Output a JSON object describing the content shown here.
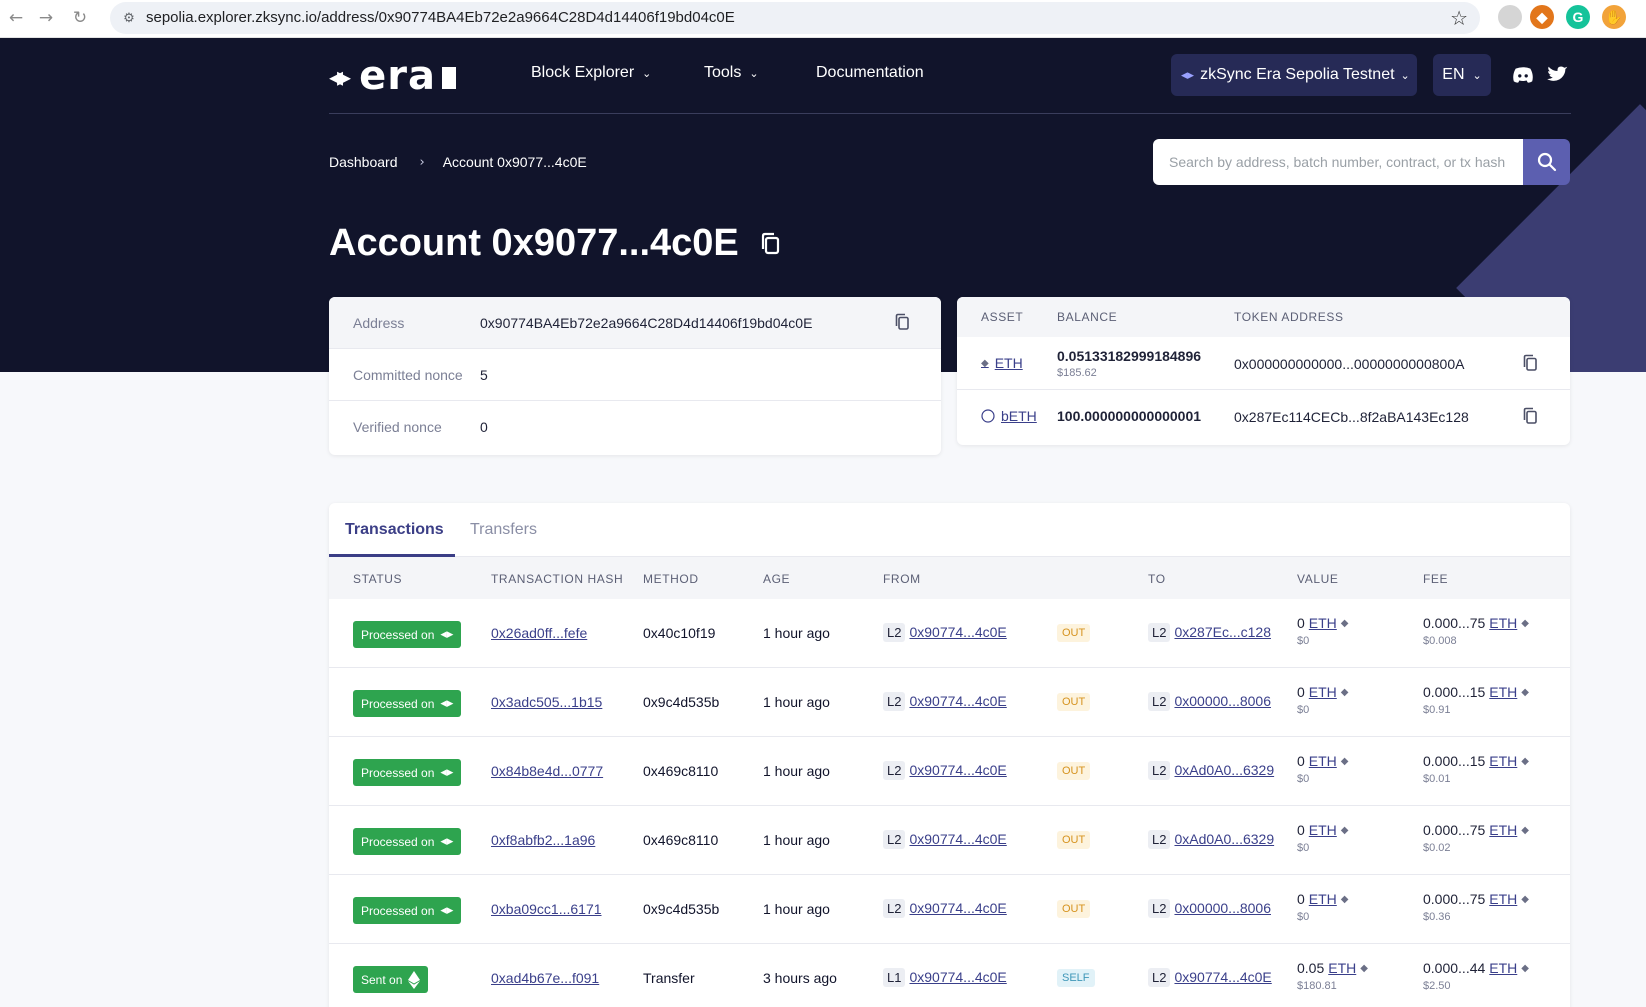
{
  "browser": {
    "url": "sepolia.explorer.zksync.io/address/0x90774BA4Eb72e2a9664C28D4d14406f19bd04c0E"
  },
  "header": {
    "logo": "era",
    "menu": [
      {
        "label": "Block Explorer"
      },
      {
        "label": "Tools"
      },
      {
        "label": "Documentation"
      }
    ],
    "network": "zkSync Era Sepolia Testnet",
    "language": "EN"
  },
  "breadcrumb": {
    "home": "Dashboard",
    "current": "Account 0x9077...4c0E"
  },
  "search": {
    "placeholder": "Search by address, batch number, contract, or tx hash"
  },
  "page": {
    "title": "Account 0x9077...4c0E"
  },
  "account_info": {
    "address_label": "Address",
    "address_value": "0x90774BA4Eb72e2a9664C28D4d14406f19bd04c0E",
    "committed_label": "Committed nonce",
    "committed_value": "5",
    "verified_label": "Verified nonce",
    "verified_value": "0"
  },
  "assets": {
    "headers": {
      "asset": "ASSET",
      "balance": "BALANCE",
      "token_address": "TOKEN ADDRESS"
    },
    "rows": [
      {
        "name": "ETH",
        "balance": "0.05133182999184896",
        "usd": "$185.62",
        "address": "0x000000000000...0000000000800A"
      },
      {
        "name": "bETH",
        "balance": "100.000000000000001",
        "usd": "",
        "address": "0x287Ec114CECb...8f2aBA143Ec128"
      }
    ]
  },
  "tabs": {
    "transactions": "Transactions",
    "transfers": "Transfers"
  },
  "tx_table": {
    "headers": {
      "status": "STATUS",
      "hash": "TRANSACTION HASH",
      "method": "METHOD",
      "age": "AGE",
      "from": "FROM",
      "to": "TO",
      "value": "VALUE",
      "fee": "FEE"
    },
    "rows": [
      {
        "status": "Processed on",
        "hash": "0x26ad0ff...fefe",
        "method": "0x40c10f19",
        "age": "1 hour ago",
        "from_layer": "L2",
        "from": "0x90774...4c0E",
        "direction": "OUT",
        "to_layer": "L2",
        "to": "0x287Ec...c128",
        "value": "0",
        "value_token": "ETH",
        "value_usd": "$0",
        "fee": "0.000...75",
        "fee_token": "ETH",
        "fee_usd": "$0.008"
      },
      {
        "status": "Processed on",
        "hash": "0x3adc505...1b15",
        "method": "0x9c4d535b",
        "age": "1 hour ago",
        "from_layer": "L2",
        "from": "0x90774...4c0E",
        "direction": "OUT",
        "to_layer": "L2",
        "to": "0x00000...8006",
        "value": "0",
        "value_token": "ETH",
        "value_usd": "$0",
        "fee": "0.000...15",
        "fee_token": "ETH",
        "fee_usd": "$0.91"
      },
      {
        "status": "Processed on",
        "hash": "0x84b8e4d...0777",
        "method": "0x469c8110",
        "age": "1 hour ago",
        "from_layer": "L2",
        "from": "0x90774...4c0E",
        "direction": "OUT",
        "to_layer": "L2",
        "to": "0xAd0A0...6329",
        "value": "0",
        "value_token": "ETH",
        "value_usd": "$0",
        "fee": "0.000...15",
        "fee_token": "ETH",
        "fee_usd": "$0.01"
      },
      {
        "status": "Processed on",
        "hash": "0xf8abfb2...1a96",
        "method": "0x469c8110",
        "age": "1 hour ago",
        "from_layer": "L2",
        "from": "0x90774...4c0E",
        "direction": "OUT",
        "to_layer": "L2",
        "to": "0xAd0A0...6329",
        "value": "0",
        "value_token": "ETH",
        "value_usd": "$0",
        "fee": "0.000...75",
        "fee_token": "ETH",
        "fee_usd": "$0.02"
      },
      {
        "status": "Processed on",
        "hash": "0xba09cc1...6171",
        "method": "0x9c4d535b",
        "age": "1 hour ago",
        "from_layer": "L2",
        "from": "0x90774...4c0E",
        "direction": "OUT",
        "to_layer": "L2",
        "to": "0x00000...8006",
        "value": "0",
        "value_token": "ETH",
        "value_usd": "$0",
        "fee": "0.000...75",
        "fee_token": "ETH",
        "fee_usd": "$0.36"
      },
      {
        "status": "Sent on",
        "hash": "0xad4b67e...f091",
        "method": "Transfer",
        "age": "3 hours ago",
        "from_layer": "L1",
        "from": "0x90774...4c0E",
        "direction": "SELF",
        "to_layer": "L2",
        "to": "0x90774...4c0E",
        "value": "0.05",
        "value_token": "ETH",
        "value_usd": "$180.81",
        "fee": "0.000...44",
        "fee_token": "ETH",
        "fee_usd": "$2.50"
      }
    ]
  },
  "colors": {
    "hero_bg": "#11142b",
    "accent": "#5c5fb0",
    "status_green": "#2ea44f",
    "link": "#3a3f8a"
  }
}
